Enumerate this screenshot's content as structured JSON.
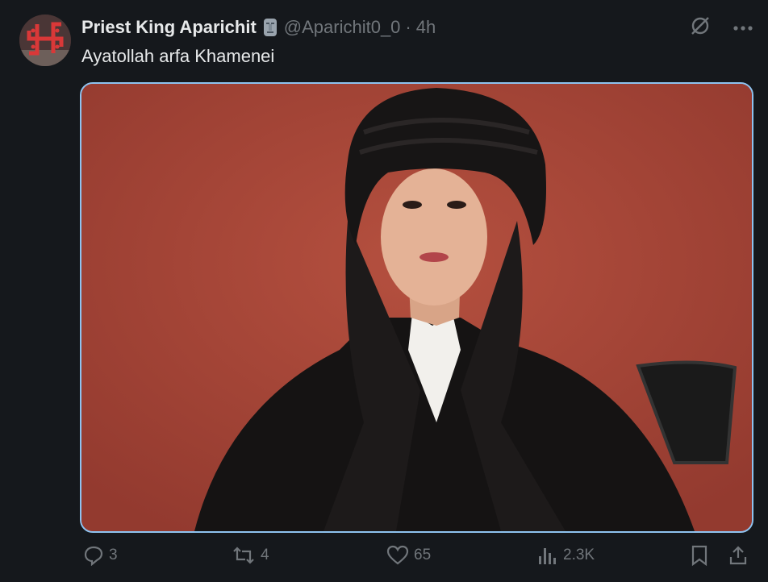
{
  "tweet": {
    "author_name": "Priest King Aparichit",
    "badge_icon": "moai-emoji-icon",
    "handle": "@Aparichit0_0",
    "separator": "·",
    "time": "4h",
    "text": "Ayatollah arfa Khamenei"
  },
  "top_icons": [
    "grok-icon",
    "more-icon"
  ],
  "media": {
    "description_icon": "photo",
    "border_color": "#8ec3f0"
  },
  "actions": {
    "replies": "3",
    "reposts": "4",
    "likes": "65",
    "views": "2.3K"
  },
  "colors": {
    "background": "#15181c",
    "text": "#e7e9ea",
    "muted": "#71767b"
  }
}
